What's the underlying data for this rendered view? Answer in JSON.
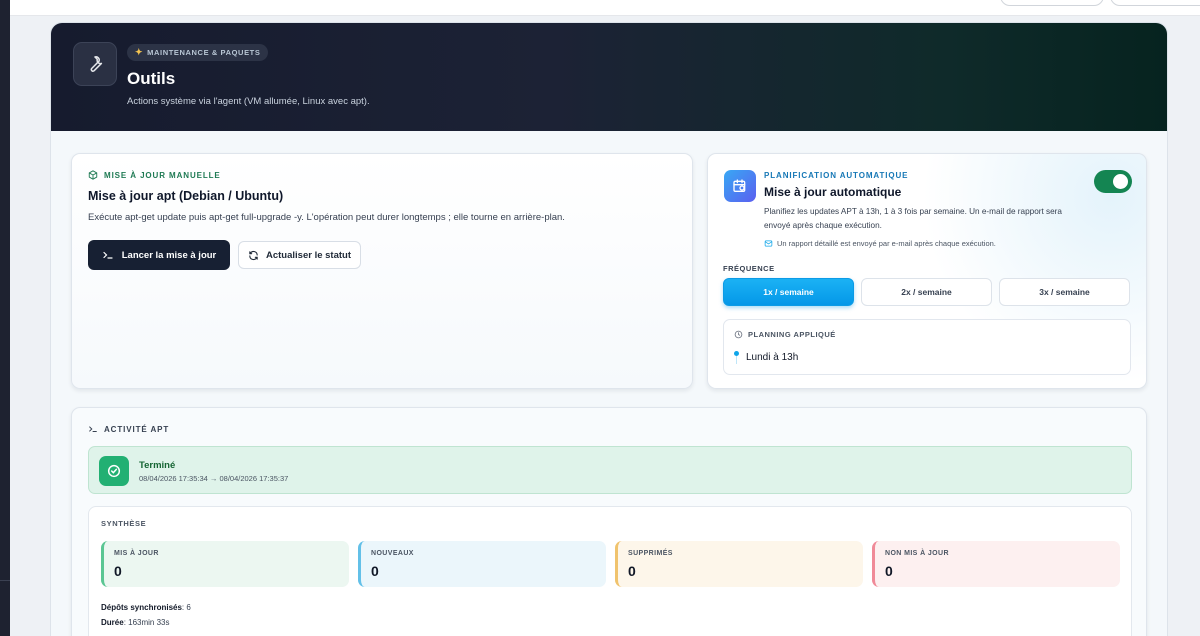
{
  "hero": {
    "badge": "MAINTENANCE & PAQUETS",
    "title": "Outils",
    "subtitle": "Actions système via l'agent (VM allumée, Linux avec apt)."
  },
  "manual": {
    "section": "MISE À JOUR MANUELLE",
    "title": "Mise à jour apt (Debian / Ubuntu)",
    "description": "Exécute apt-get update puis apt-get full-upgrade -y. L'opération peut durer longtemps ; elle tourne en arrière-plan.",
    "run_button": "Lancer la mise à jour",
    "refresh_button": "Actualiser le statut"
  },
  "auto": {
    "section": "PLANIFICATION AUTOMATIQUE",
    "title": "Mise à jour automatique",
    "description": "Planifiez les updates APT à 13h, 1 à 3 fois par semaine. Un e-mail de rapport sera envoyé après chaque exécution.",
    "note": "Un rapport détaillé est envoyé par e-mail après chaque exécution.",
    "toggle_on": true,
    "frequency_label": "FRÉQUENCE",
    "frequency_options": [
      "1x / semaine",
      "2x / semaine",
      "3x / semaine"
    ],
    "frequency_selected": "1x / semaine",
    "planning_label": "PLANNING APPLIQUÉ",
    "planning_value": "Lundi à 13h"
  },
  "activity": {
    "section": "ACTIVITÉ APT",
    "status_title": "Terminé",
    "status_time": "08/04/2026 17:35:34 → 08/04/2026 17:35:37",
    "synth_label": "SYNTHÈSE",
    "stats": [
      {
        "label": "MIS À JOUR",
        "value": "0"
      },
      {
        "label": "NOUVEAUX",
        "value": "0"
      },
      {
        "label": "SUPPRIMÉS",
        "value": "0"
      },
      {
        "label": "NON MIS À JOUR",
        "value": "0"
      }
    ],
    "repos_label": "Dépôts synchronisés",
    "repos_value": ": 6",
    "duration_label": "Durée",
    "duration_value": ": 163min 33s"
  },
  "colors": {
    "accent": "#0497e8",
    "success": "#22b073",
    "dark": "#172033"
  }
}
